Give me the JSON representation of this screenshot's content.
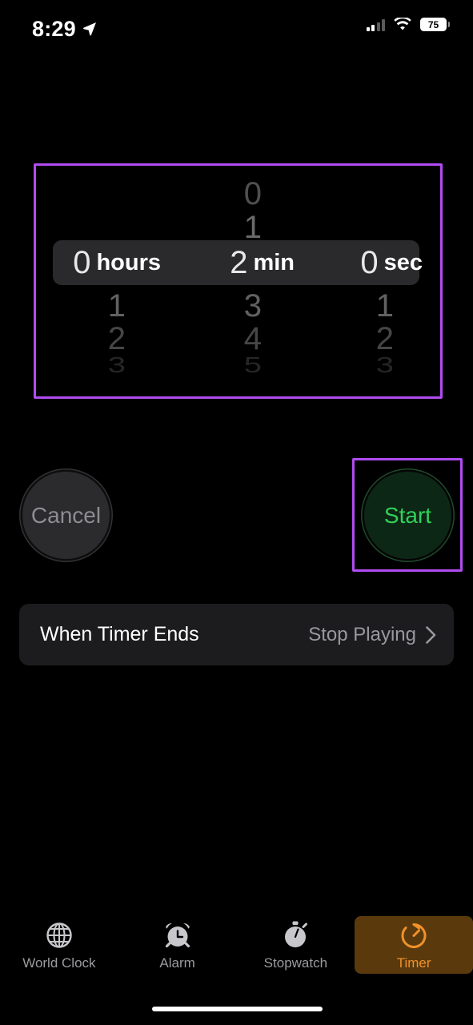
{
  "status_bar": {
    "time": "8:29",
    "location_icon": "location-arrow-icon",
    "signal_icon": "cellular-signal-icon",
    "wifi_icon": "wifi-icon",
    "battery_level": "75"
  },
  "timer_picker": {
    "highlighted": true,
    "highlight_color": "#b14cf0",
    "columns": [
      {
        "name": "hours",
        "unit_label": "hours",
        "selected_value": "0",
        "values_above": [],
        "values_below": [
          "1",
          "2",
          "3"
        ]
      },
      {
        "name": "minutes",
        "unit_label": "min",
        "selected_value": "2",
        "values_above": [
          "0",
          "1"
        ],
        "values_below": [
          "3",
          "4",
          "5"
        ]
      },
      {
        "name": "seconds",
        "unit_label": "sec",
        "selected_value": "0",
        "values_above": [],
        "values_below": [
          "1",
          "2",
          "3"
        ]
      }
    ]
  },
  "actions": {
    "cancel_label": "Cancel",
    "start_label": "Start",
    "start_color": "#30d158",
    "start_highlighted": true,
    "highlight_color": "#b14cf0"
  },
  "settings_row": {
    "title": "When Timer Ends",
    "value": "Stop Playing",
    "chevron_icon": "chevron-right-icon"
  },
  "tab_bar": {
    "active_tab": "Timer",
    "active_color": "#f0912a",
    "active_background": "#5a3a0d",
    "tabs": [
      {
        "label": "World Clock",
        "icon": "globe-icon"
      },
      {
        "label": "Alarm",
        "icon": "alarm-clock-icon"
      },
      {
        "label": "Stopwatch",
        "icon": "stopwatch-icon"
      },
      {
        "label": "Timer",
        "icon": "timer-icon"
      }
    ]
  }
}
